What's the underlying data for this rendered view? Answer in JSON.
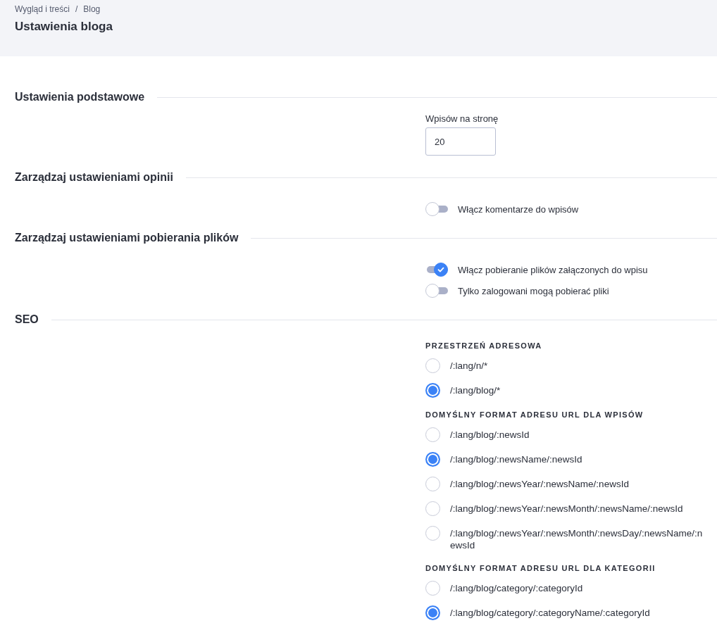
{
  "breadcrumb": {
    "items": [
      "Wygląd i treści",
      "Blog"
    ],
    "separator": "/"
  },
  "title": "Ustawienia bloga",
  "sections": [
    {
      "title": "Ustawienia podstawowe",
      "fields": [
        {
          "kind": "number",
          "label": "Wpisów na stronę",
          "value": "20"
        }
      ]
    },
    {
      "title": "Zarządzaj ustawieniami opinii",
      "fields": [
        {
          "kind": "toggle",
          "label": "Włącz komentarze do wpisów",
          "on": false
        }
      ]
    },
    {
      "title": "Zarządzaj ustawieniami pobierania plików",
      "fields": [
        {
          "kind": "toggle",
          "label": "Włącz pobieranie plików załączonych do wpisu",
          "on": true
        },
        {
          "kind": "toggle",
          "label": "Tylko zalogowani mogą pobierać pliki",
          "on": false
        }
      ]
    },
    {
      "title": "SEO",
      "fields": [
        {
          "kind": "radio_group",
          "heading": "PRZESTRZEŃ ADRESOWA",
          "options": [
            {
              "label": "/:lang/n/*",
              "selected": false
            },
            {
              "label": "/:lang/blog/*",
              "selected": true
            }
          ]
        },
        {
          "kind": "radio_group",
          "heading": "DOMYŚLNY FORMAT ADRESU URL DLA WPISÓW",
          "options": [
            {
              "label": "/:lang/blog/:newsId",
              "selected": false
            },
            {
              "label": "/:lang/blog/:newsName/:newsId",
              "selected": true
            },
            {
              "label": "/:lang/blog/:newsYear/:newsName/:newsId",
              "selected": false
            },
            {
              "label": "/:lang/blog/:newsYear/:newsMonth/:newsName/:newsId",
              "selected": false
            },
            {
              "label": "/:lang/blog/:newsYear/:newsMonth/:newsDay/:newsName/:newsId",
              "selected": false
            }
          ]
        },
        {
          "kind": "radio_group",
          "heading": "DOMYŚLNY FORMAT ADRESU URL DLA KATEGORII",
          "options": [
            {
              "label": "/:lang/blog/category/:categoryId",
              "selected": false
            },
            {
              "label": "/:lang/blog/category/:categoryName/:categoryId",
              "selected": true
            }
          ]
        }
      ]
    }
  ]
}
